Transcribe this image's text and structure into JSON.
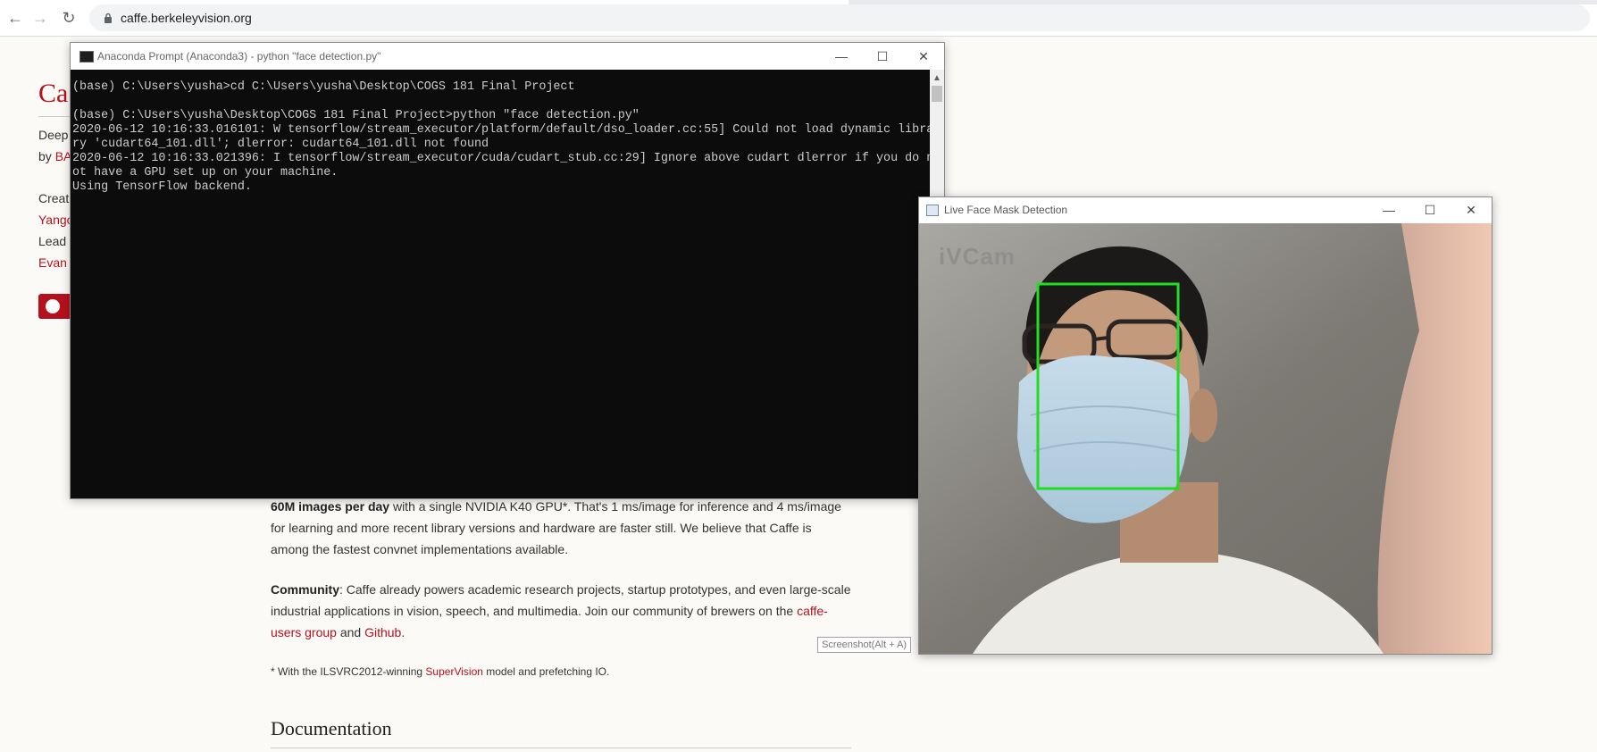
{
  "browser": {
    "url": "caffe.berkeleyvision.org"
  },
  "page": {
    "title_partial": "Ca",
    "side": {
      "line1": "Deep",
      "line2_prefix": "by ",
      "line2_link": "BA",
      "line3": "Creat",
      "line4_link": "Yango",
      "line5": "Lead",
      "line6_link": "Evan"
    },
    "speed_bold": "60M images per day",
    "speed_text": " with a single NVIDIA K40 GPU*. That's 1 ms/image for inference and 4 ms/image for learning and more recent library versions and hardware are faster still. We believe that Caffe is among the fastest convnet implementations available.",
    "community_bold": "Community",
    "community_text": ": Caffe already powers academic research projects, startup prototypes, and even large-scale industrial applications in vision, speech, and multimedia. Join our community of brewers on the ",
    "community_link1": "caffe-users group",
    "community_and": " and ",
    "community_link2": "Github",
    "community_end": ".",
    "footnote_prefix": "* With the ILSVRC2012-winning ",
    "footnote_link": "SuperVision",
    "footnote_suffix": " model and prefetching IO.",
    "documentation_heading": "Documentation"
  },
  "console": {
    "title": "Anaconda Prompt (Anaconda3) - python  \"face detection.py\"",
    "output": "(base) C:\\Users\\yusha>cd C:\\Users\\yusha\\Desktop\\COGS 181 Final Project\n\n(base) C:\\Users\\yusha\\Desktop\\COGS 181 Final Project>python \"face detection.py\"\n2020-06-12 10:16:33.016101: W tensorflow/stream_executor/platform/default/dso_loader.cc:55] Could not load dynamic libra\nry 'cudart64_101.dll'; dlerror: cudart64_101.dll not found\n2020-06-12 10:16:33.021396: I tensorflow/stream_executor/cuda/cudart_stub.cc:29] Ignore above cudart dlerror if you do n\not have a GPU set up on your machine.\nUsing TensorFlow backend."
  },
  "detection_window": {
    "title": "Live Face Mask Detection",
    "watermark": "iVCam",
    "box_color": "#22dd22"
  },
  "window_buttons": {
    "minimize": "—",
    "maximize": "☐",
    "close": "✕"
  },
  "tooltip": "Screenshot(Alt + A)"
}
